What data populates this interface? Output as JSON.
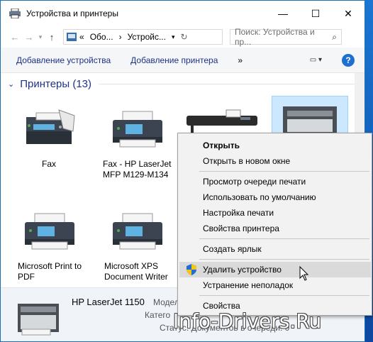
{
  "window": {
    "title": "Устройства и принтеры",
    "minimize": "—",
    "maximize": "☐",
    "close": "✕"
  },
  "address": {
    "chevron": "«",
    "segments": [
      "Обо...",
      "Устройс..."
    ],
    "search_placeholder": "Поиск: Устройства и пр..."
  },
  "commands": {
    "add_device": "Добавление устройства",
    "add_printer": "Добавление принтера",
    "more": "»",
    "help": "?"
  },
  "section": {
    "title": "Принтеры (13)"
  },
  "devices": [
    {
      "label": "Fax"
    },
    {
      "label": "Fax - HP LaserJet MFP M129-M134"
    },
    {
      "label": "Microsoft Print to PDF"
    },
    {
      "label": "Microsoft XPS Document Writer"
    }
  ],
  "details": {
    "name": "HP LaserJet 1150",
    "model_label": "Модел",
    "category_label": "Катего",
    "status_label": "Статус: Документов в очереди: 0"
  },
  "context_menu": {
    "items": [
      {
        "label": "Открыть"
      },
      {
        "label": "Открыть в новом окне"
      },
      {
        "label": "Просмотр очереди печати"
      },
      {
        "label": "Использовать по умолчанию"
      },
      {
        "label": "Настройка печати"
      },
      {
        "label": "Свойства принтера"
      },
      {
        "label": "Создать ярлык"
      },
      {
        "label": "Удалить устройство"
      },
      {
        "label": "Устранение неполадок"
      },
      {
        "label": "Свойства"
      }
    ]
  },
  "watermark": "Info-Drivers.Ru",
  "colors": {
    "accent": "#1e3287",
    "help": "#1f6fd0",
    "menu_bg": "#f2f2f2",
    "menu_hover": "#dadada"
  }
}
